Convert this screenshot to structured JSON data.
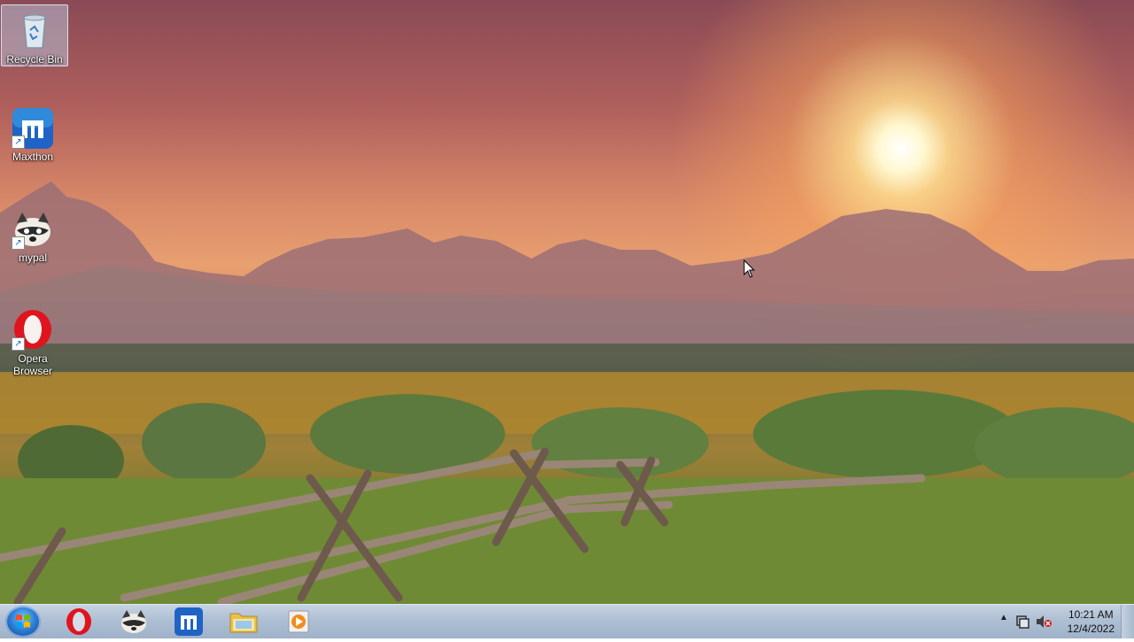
{
  "desktop": {
    "icons": [
      {
        "label": "Recycle Bin",
        "icon": "recycle-bin-icon"
      },
      {
        "label": "Maxthon",
        "icon": "maxthon-icon"
      },
      {
        "label": "mypal",
        "icon": "mypal-icon"
      },
      {
        "label": "Opera Browser",
        "icon": "opera-icon"
      }
    ]
  },
  "taskbar": {
    "start_icon": "windows-start-icon",
    "pinned": [
      {
        "name": "Opera",
        "icon": "opera-icon"
      },
      {
        "name": "mypal",
        "icon": "mypal-icon"
      },
      {
        "name": "Maxthon",
        "icon": "maxthon-icon"
      },
      {
        "name": "Windows Explorer",
        "icon": "folder-icon"
      },
      {
        "name": "Media Player",
        "icon": "media-player-icon"
      }
    ],
    "tray": {
      "show_hidden_glyph": "▲",
      "time": "10:21 AM",
      "date": "12/4/2022"
    }
  },
  "colors": {
    "taskbar": "#aebfd3",
    "opera_red": "#e0141e",
    "maxthon_blue": "#1f63c6"
  }
}
